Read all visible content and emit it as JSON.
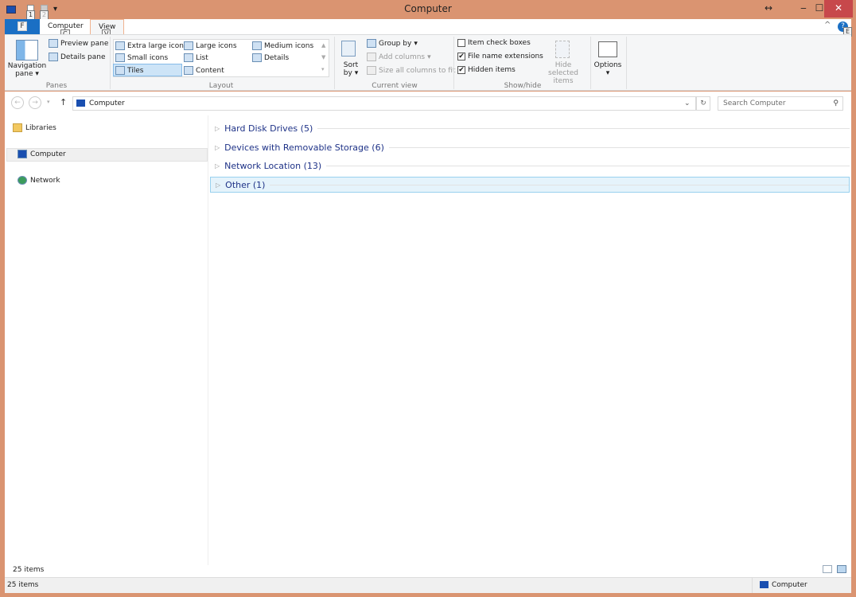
{
  "window": {
    "title": "Computer",
    "minimize": "‒",
    "maximize": "☐",
    "close": "✕",
    "resize_icon": "↔"
  },
  "qat": {
    "key1": "1",
    "key2": "2"
  },
  "tabs": {
    "file": "F",
    "computer": "Computer",
    "view": "View",
    "key_c": "C",
    "key_v": "V",
    "help_key": "E"
  },
  "ribbon": {
    "panes": {
      "navigation_pane": "Navigation pane",
      "preview_pane": "Preview pane",
      "details_pane": "Details pane",
      "label": "Panes"
    },
    "layout": {
      "items": [
        "Extra large icons",
        "Large icons",
        "Medium icons",
        "Small icons",
        "List",
        "Details",
        "Tiles",
        "Content"
      ],
      "selected": "Tiles",
      "label": "Layout"
    },
    "current_view": {
      "sort_by": "Sort by",
      "group_by": "Group by",
      "add_columns": "Add columns",
      "size_columns": "Size all columns to fit",
      "label": "Current view"
    },
    "show_hide": {
      "item_check_boxes": "Item check boxes",
      "item_check_boxes_checked": false,
      "file_name_extensions": "File name extensions",
      "file_name_extensions_checked": true,
      "hidden_items": "Hidden items",
      "hidden_items_checked": true,
      "hide_selected": "Hide selected items",
      "label": "Show/hide"
    },
    "options": "Options"
  },
  "address": {
    "path": "Computer",
    "search_placeholder": "Search Computer"
  },
  "nav": {
    "items": [
      "Libraries",
      "Computer",
      "Network"
    ],
    "selected": "Computer"
  },
  "groups": [
    "Hard Disk Drives (5)",
    "Devices with Removable Storage (6)",
    "Network Location (13)",
    "Other (1)"
  ],
  "status": {
    "count_inner": "25 items",
    "count": "25 items",
    "location": "Computer"
  },
  "colors": {
    "frame": "#da9471",
    "accent": "#1a6fc4",
    "close": "#c7484b",
    "group_text": "#1e3287"
  }
}
